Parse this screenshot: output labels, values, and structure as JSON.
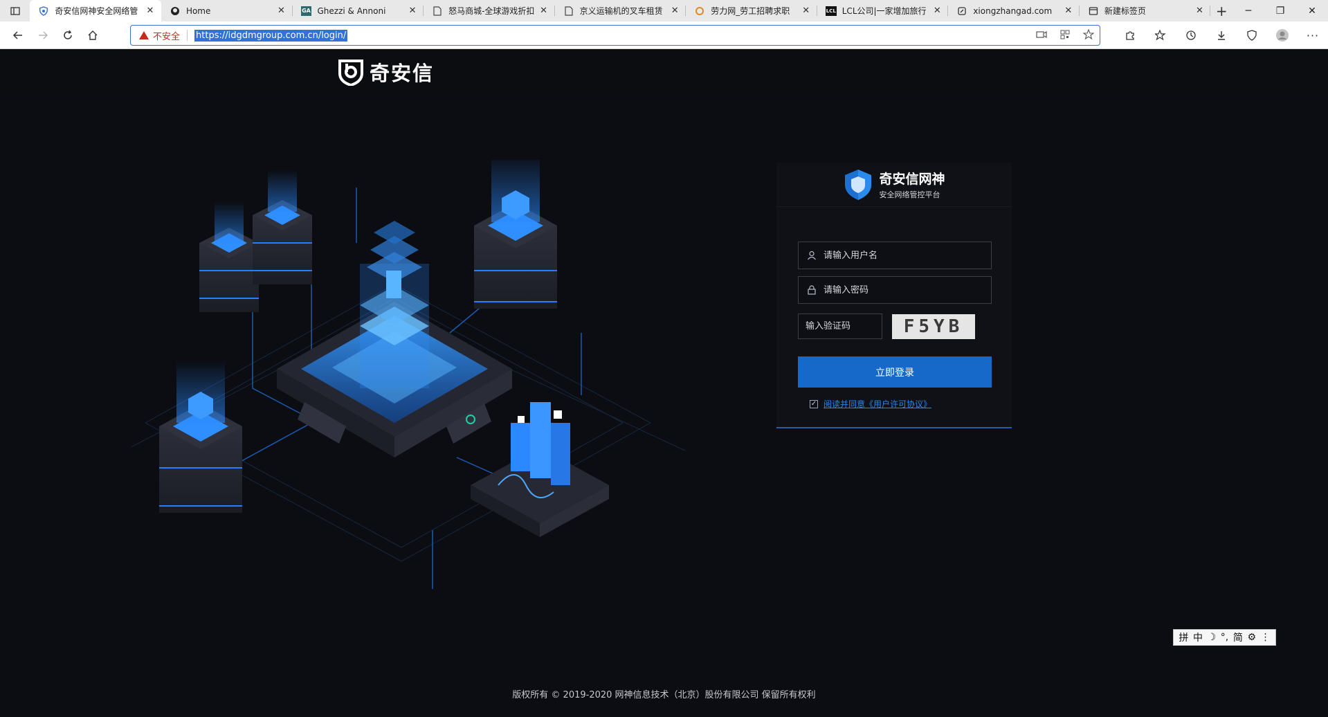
{
  "browser": {
    "tabs": [
      {
        "title": "奇安信网神安全网络管",
        "icon": "shield-icon",
        "active": true
      },
      {
        "title": "Home",
        "icon": "github-icon",
        "active": false
      },
      {
        "title": "Ghezzi & Annoni",
        "icon": "ga-icon",
        "active": false
      },
      {
        "title": "怒马商城-全球游戏折扣",
        "icon": "page-icon",
        "active": false
      },
      {
        "title": "京义运输机的叉车租赁",
        "icon": "page-icon",
        "active": false
      },
      {
        "title": "劳力网_劳工招聘求职",
        "icon": "swirl-icon",
        "active": false
      },
      {
        "title": "LCL公司|一家增加旅行",
        "icon": "lcl-icon",
        "active": false
      },
      {
        "title": "xiongzhangad.com",
        "icon": "link-icon",
        "active": false
      },
      {
        "title": "新建标签页",
        "icon": "newtab-icon",
        "active": false
      }
    ],
    "ga_badge": "GA",
    "lcl_badge": "LCL",
    "address": {
      "security_label": "不安全",
      "url": "https://idgdmgroup.com.cn/login/"
    }
  },
  "page": {
    "brand": "奇安信",
    "card": {
      "title": "奇安信网神",
      "subtitle": "安全网络管控平台"
    },
    "username_placeholder": "请输入用户名",
    "password_placeholder": "请输入密码",
    "captcha_placeholder": "输入验证码",
    "captcha_text": "F5YB",
    "login_label": "立即登录",
    "agree_text": "阅读并同意《用户许可协议》",
    "footer": "版权所有 © 2019-2020 网神信息技术（北京）股份有限公司 保留所有权利"
  },
  "ime": {
    "items": [
      "拼",
      "中",
      "☽",
      "°,",
      "简",
      "⚙",
      "⋮"
    ]
  },
  "colors": {
    "accent": "#1469c9",
    "link": "#2a86e8",
    "warning": "#c42b1c",
    "background": "#0b0d13"
  }
}
